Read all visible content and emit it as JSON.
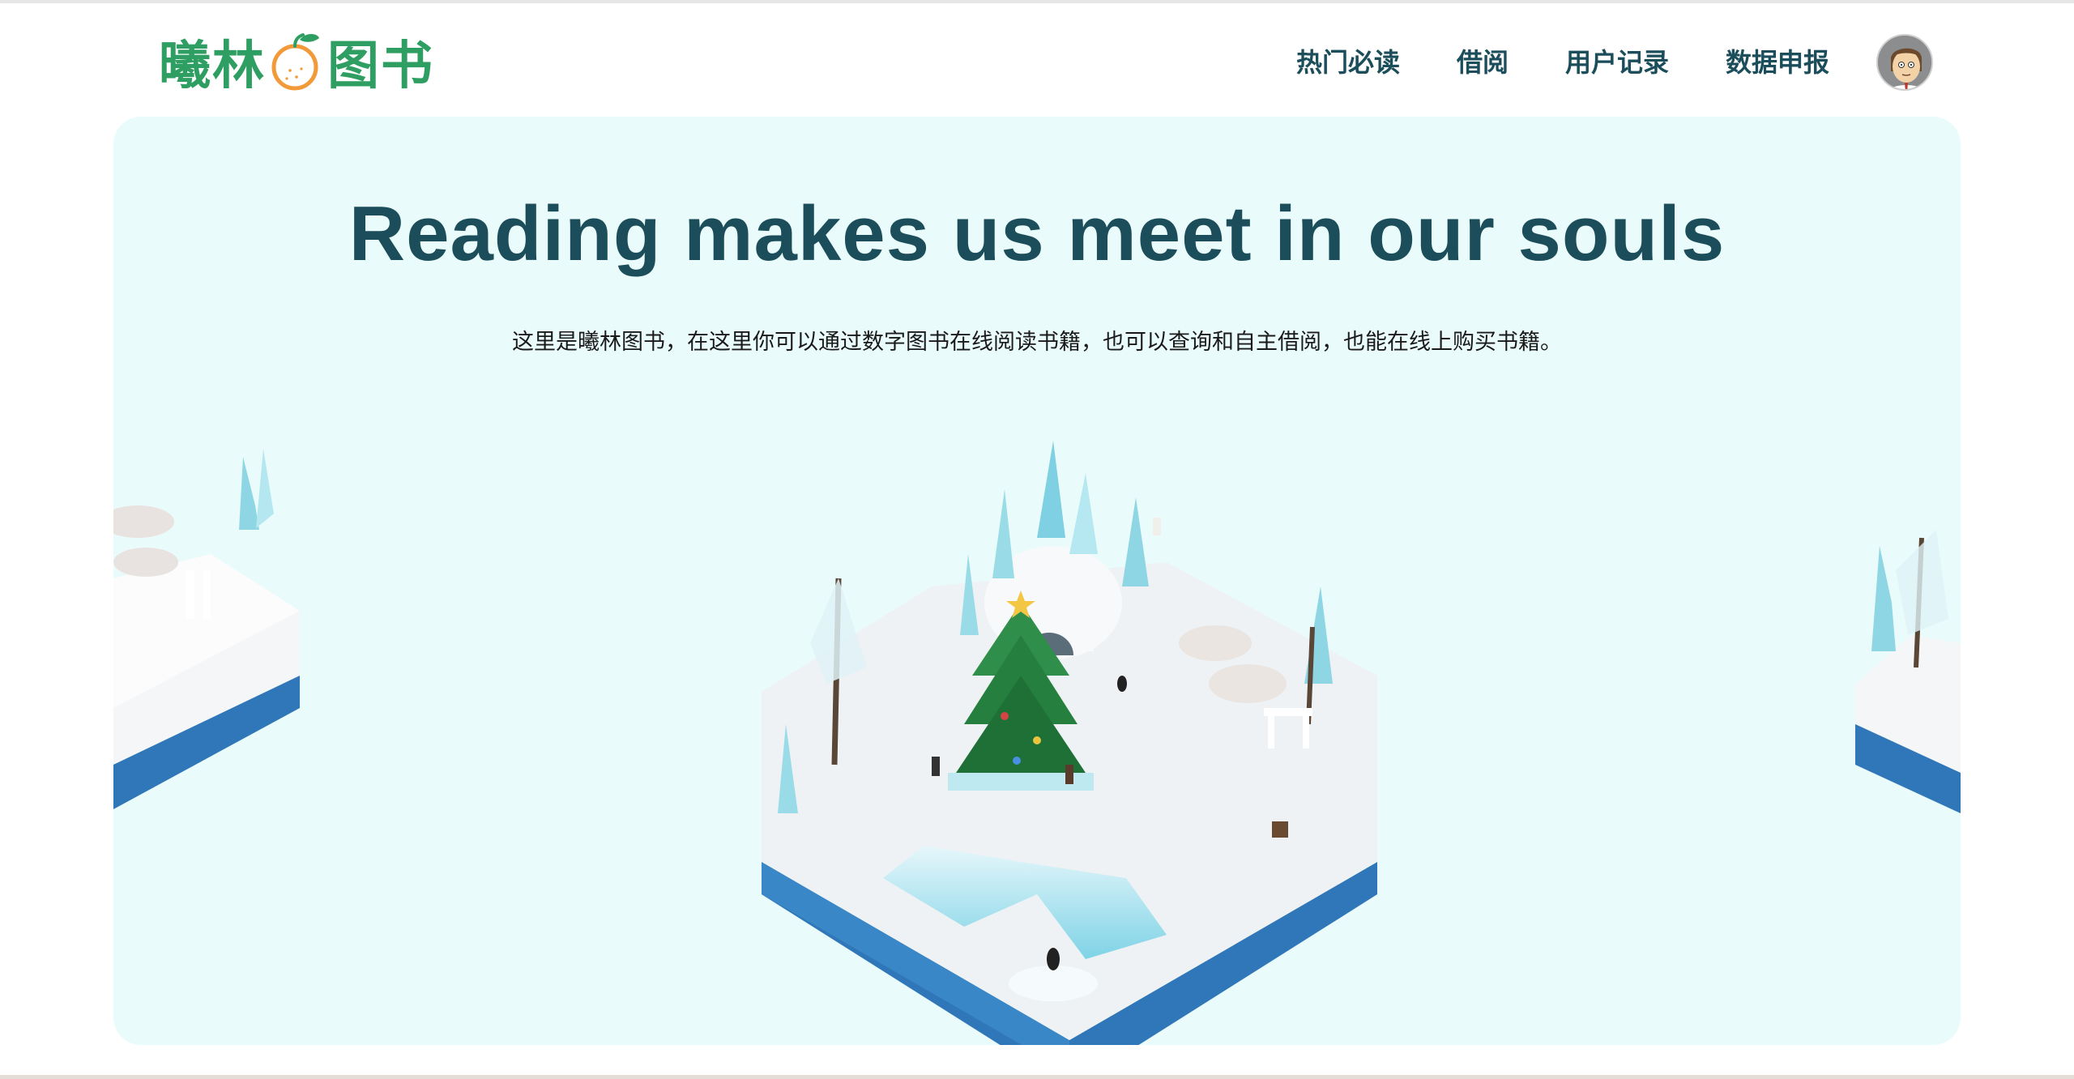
{
  "header": {
    "logo": {
      "text_left": "曦林",
      "text_right": "图书"
    },
    "nav": [
      {
        "label": "热门必读"
      },
      {
        "label": "借阅"
      },
      {
        "label": "用户记录"
      },
      {
        "label": "数据申报"
      }
    ]
  },
  "hero": {
    "title": "Reading makes us meet in our souls",
    "subtitle": "这里是曦林图书，在这里你可以通过数字图书在线阅读书籍，也可以查询和自主借阅，也能在线上购买书籍。"
  },
  "icons": {
    "logo_orange": "orange-fruit-icon",
    "avatar": "user-avatar"
  },
  "colors": {
    "brand_green": "#2f9e62",
    "nav_text": "#1b4d5a",
    "hero_bg": "#eafbfb",
    "orange": "#f29a3a"
  }
}
